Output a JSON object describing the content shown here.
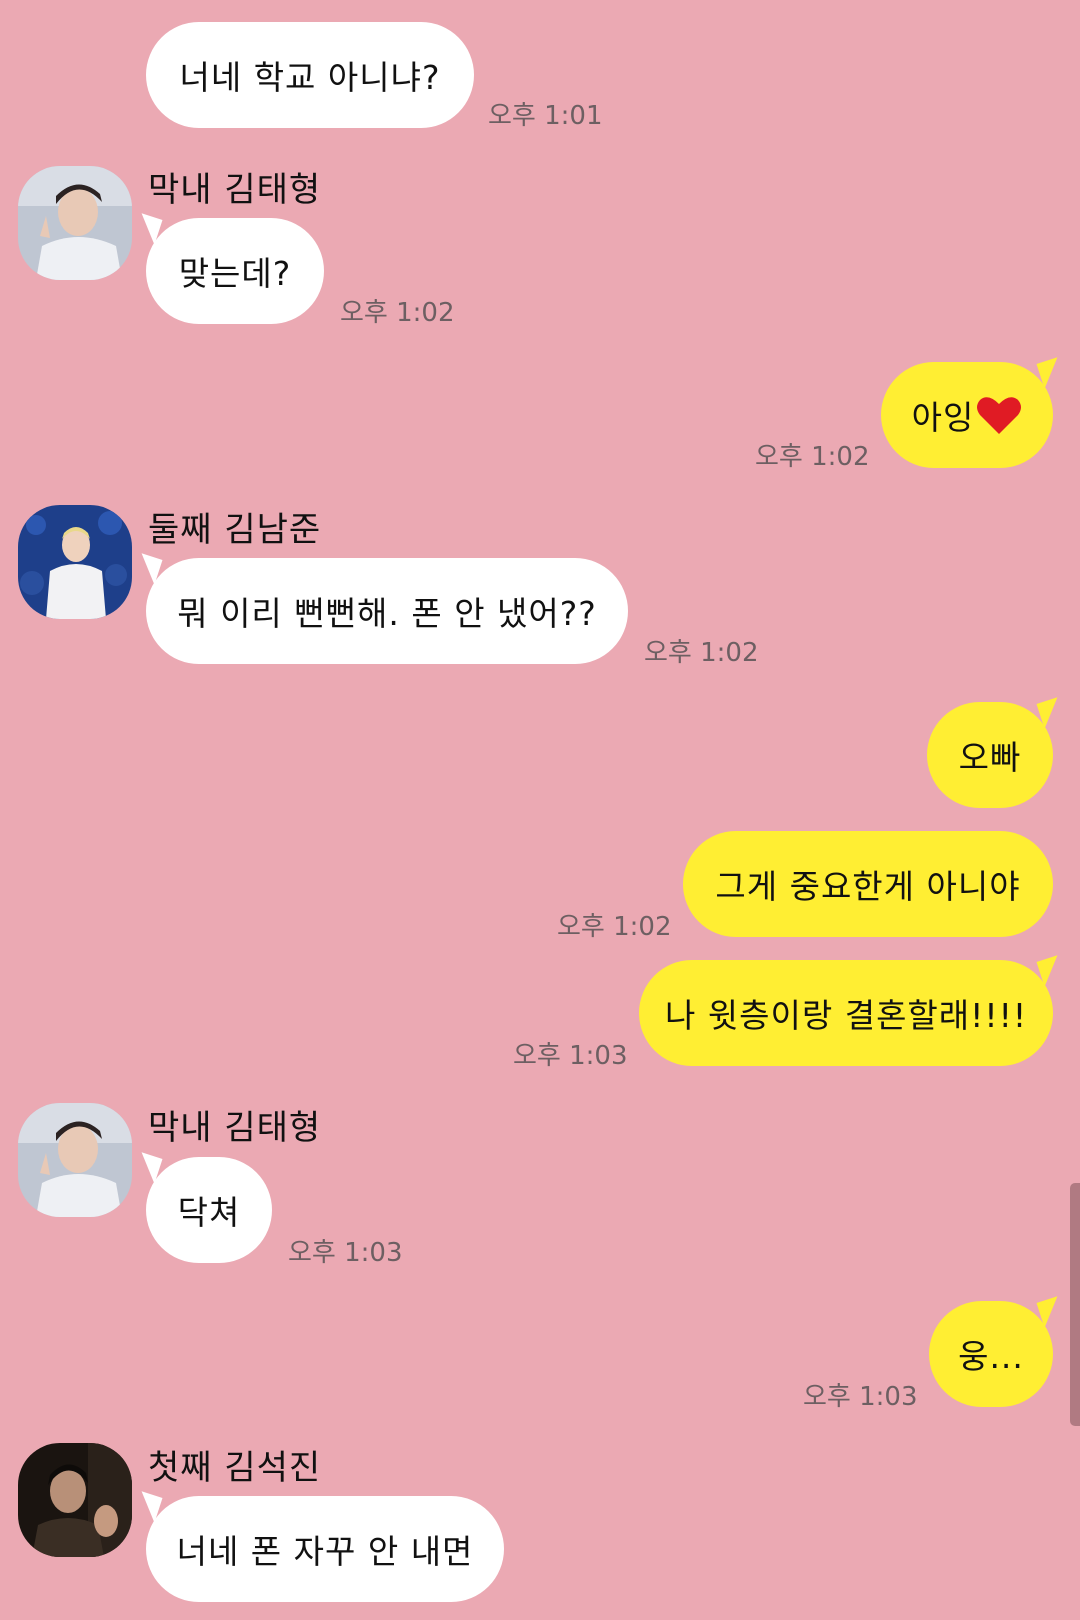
{
  "colors": {
    "background": "#eba9b3",
    "incoming_bubble": "#ffffff",
    "outgoing_bubble": "#ffee33",
    "timestamp": "#6d5f62"
  },
  "messages": [
    {
      "direction": "in",
      "text": "너네 학교 아니냐?",
      "time": "오후 1:01"
    },
    {
      "direction": "in",
      "sender": "막내 김태형",
      "avatar": "taehyung-avatar",
      "text": "맞는데?",
      "time": "오후 1:02"
    },
    {
      "direction": "out",
      "text": "아잉",
      "emoji": "red-heart-icon",
      "time": "오후 1:02"
    },
    {
      "direction": "in",
      "sender": "둘째 김남준",
      "avatar": "namjoon-avatar",
      "text": "뭐 이리 뻔뻔해. 폰 안 냈어??",
      "time": "오후 1:02"
    },
    {
      "direction": "out",
      "text": "오빠"
    },
    {
      "direction": "out",
      "text": "그게 중요한게 아니야",
      "time": "오후 1:02"
    },
    {
      "direction": "out",
      "text": "나 윗층이랑 결혼할래!!!!",
      "time": "오후 1:03"
    },
    {
      "direction": "in",
      "sender": "막내 김태형",
      "avatar": "taehyung-avatar",
      "text": "닥쳐",
      "time": "오후 1:03"
    },
    {
      "direction": "out",
      "text": "웅...",
      "time": "오후 1:03"
    },
    {
      "direction": "in",
      "sender": "첫째 김석진",
      "avatar": "seokjin-avatar",
      "text": "너네 폰 자꾸 안 내면"
    }
  ]
}
